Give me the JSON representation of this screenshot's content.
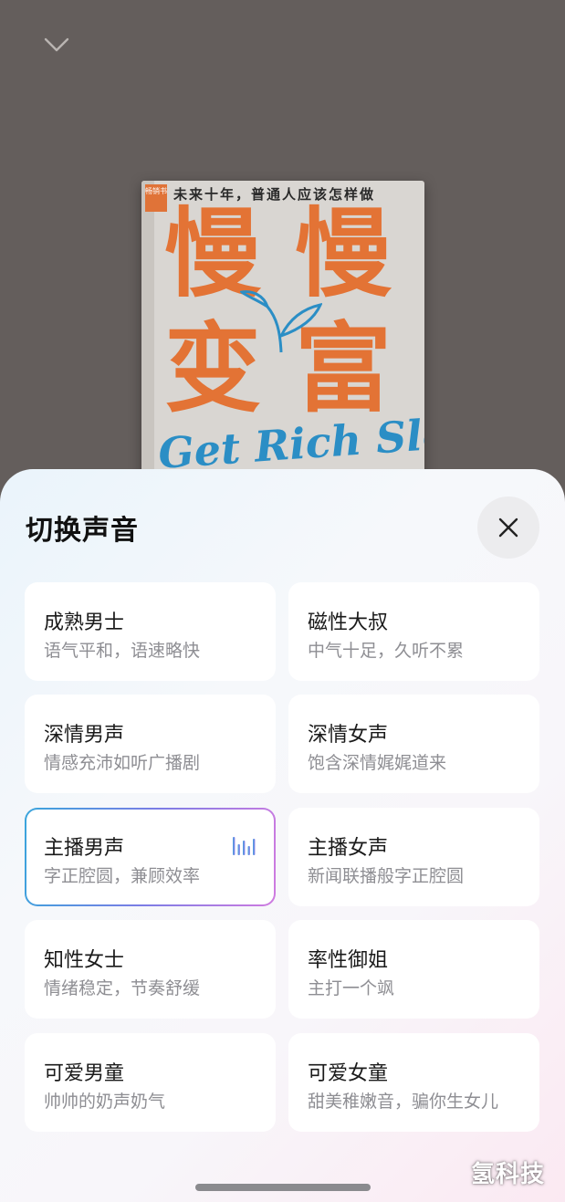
{
  "colors": {
    "backdrop": "#645e5c",
    "cover_orange": "#e37335",
    "cover_blue": "#2b8ec5",
    "selected_gradient": [
      "#3aa5dc",
      "#7b7ce5",
      "#d07be0"
    ]
  },
  "header": {
    "collapse_icon": "chevron-down-icon"
  },
  "book": {
    "subtitle": "未来十年，普通人应该怎样做",
    "badge": "畅销书",
    "title_chars": [
      "慢",
      "慢",
      "变",
      "富"
    ],
    "script_title": "Get Rich Slowly"
  },
  "sheet": {
    "title": "切换声音",
    "close_icon": "close-icon",
    "voices": [
      {
        "name": "成熟男士",
        "desc": "语气平和，语速略快",
        "selected": false
      },
      {
        "name": "磁性大叔",
        "desc": "中气十足，久听不累",
        "selected": false
      },
      {
        "name": "深情男声",
        "desc": "情感充沛如听广播剧",
        "selected": false
      },
      {
        "name": "深情女声",
        "desc": "饱含深情娓娓道来",
        "selected": false
      },
      {
        "name": "主播男声",
        "desc": "字正腔圆，兼顾效率",
        "selected": true
      },
      {
        "name": "主播女声",
        "desc": "新闻联播般字正腔圆",
        "selected": false
      },
      {
        "name": "知性女士",
        "desc": "情绪稳定，节奏舒缓",
        "selected": false
      },
      {
        "name": "率性御姐",
        "desc": "主打一个飒",
        "selected": false
      },
      {
        "name": "可爱男童",
        "desc": "帅帅的奶声奶气",
        "selected": false
      },
      {
        "name": "可爱女童",
        "desc": "甜美稚嫩音，骗你生女儿",
        "selected": false
      }
    ],
    "playing_icon": "audio-bars-icon"
  },
  "watermark": "氢科技"
}
